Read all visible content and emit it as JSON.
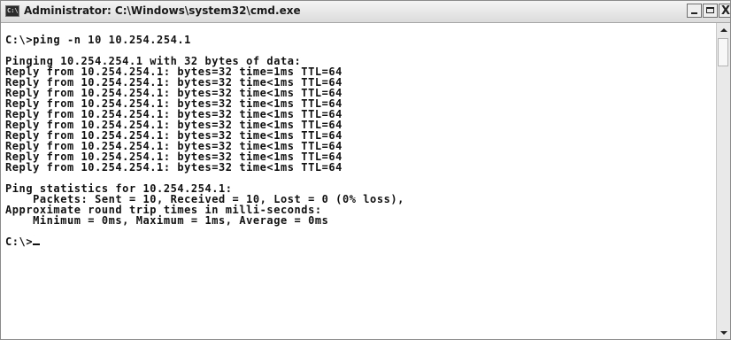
{
  "window": {
    "title": "Administrator: C:\\Windows\\system32\\cmd.exe",
    "icon": "cmd-icon",
    "controls": [
      "minimize-icon",
      "maximize-icon",
      "close-icon"
    ]
  },
  "console": {
    "lines": [
      "",
      "C:\\>ping -n 10 10.254.254.1",
      "",
      "Pinging 10.254.254.1 with 32 bytes of data:",
      "Reply from 10.254.254.1: bytes=32 time=1ms TTL=64",
      "Reply from 10.254.254.1: bytes=32 time<1ms TTL=64",
      "Reply from 10.254.254.1: bytes=32 time<1ms TTL=64",
      "Reply from 10.254.254.1: bytes=32 time<1ms TTL=64",
      "Reply from 10.254.254.1: bytes=32 time<1ms TTL=64",
      "Reply from 10.254.254.1: bytes=32 time<1ms TTL=64",
      "Reply from 10.254.254.1: bytes=32 time<1ms TTL=64",
      "Reply from 10.254.254.1: bytes=32 time<1ms TTL=64",
      "Reply from 10.254.254.1: bytes=32 time<1ms TTL=64",
      "Reply from 10.254.254.1: bytes=32 time<1ms TTL=64",
      "",
      "Ping statistics for 10.254.254.1:",
      "    Packets: Sent = 10, Received = 10, Lost = 0 (0% loss),",
      "Approximate round trip times in milli-seconds:",
      "    Minimum = 0ms, Maximum = 1ms, Average = 0ms",
      "",
      "C:\\>"
    ]
  },
  "colors": {
    "console_background": "#ffffff",
    "console_text": "#111111",
    "titlebar": "#e6e6e6"
  }
}
